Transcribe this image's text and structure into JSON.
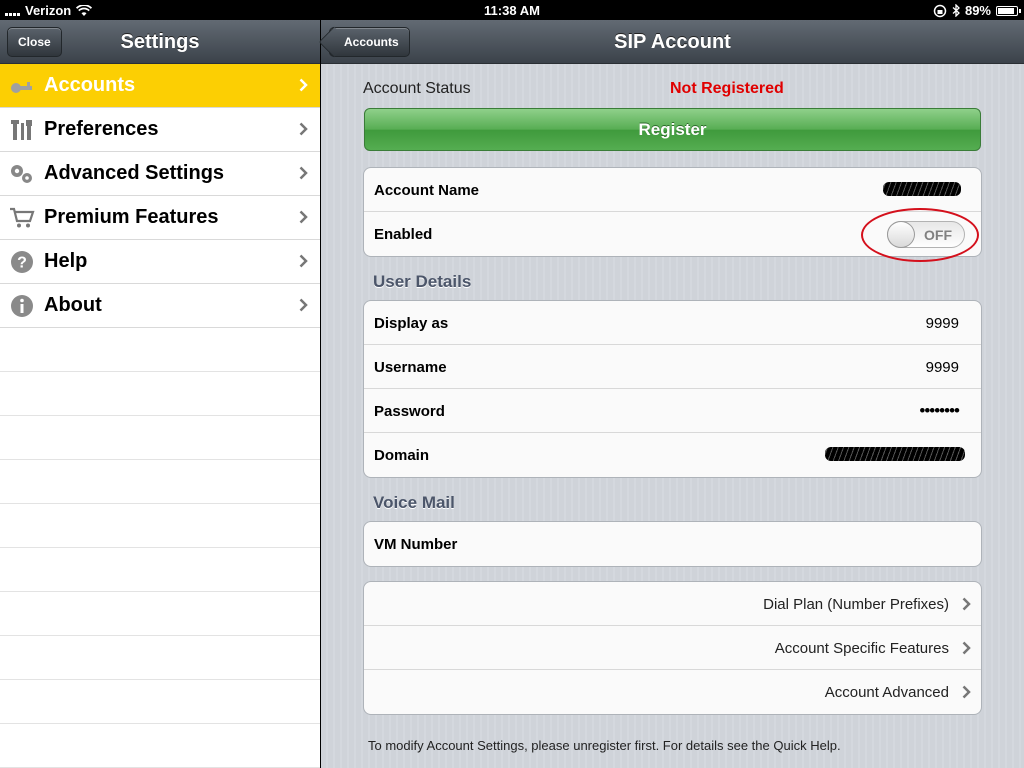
{
  "status_bar": {
    "carrier": "Verizon",
    "time": "11:38 AM",
    "battery": "89%",
    "battery_level": 0.89
  },
  "left_pane": {
    "title": "Settings",
    "close_label": "Close",
    "items": [
      {
        "label": "Accounts",
        "icon": "key-icon",
        "selected": true
      },
      {
        "label": "Preferences",
        "icon": "tools-icon",
        "selected": false
      },
      {
        "label": "Advanced Settings",
        "icon": "gears-icon",
        "selected": false
      },
      {
        "label": "Premium Features",
        "icon": "cart-icon",
        "selected": false
      },
      {
        "label": "Help",
        "icon": "help-icon",
        "selected": false
      },
      {
        "label": "About",
        "icon": "info-icon",
        "selected": false
      }
    ]
  },
  "right_pane": {
    "title": "SIP Account",
    "back_label": "Accounts",
    "account_status_label": "Account Status",
    "account_status_value": "Not Registered",
    "register_label": "Register",
    "account": {
      "name_label": "Account Name",
      "enabled_label": "Enabled",
      "enabled_value": "OFF"
    },
    "user_details": {
      "header": "User Details",
      "display_as_label": "Display as",
      "display_as_value": "9999",
      "username_label": "Username",
      "username_value": "9999",
      "password_label": "Password",
      "password_value": "••••••••",
      "domain_label": "Domain"
    },
    "voice_mail": {
      "header": "Voice Mail",
      "vm_number_label": "VM Number"
    },
    "links": {
      "dial_plan": "Dial Plan (Number Prefixes)",
      "account_specific": "Account Specific Features",
      "account_advanced": "Account Advanced"
    },
    "footnote": "To modify Account Settings, please unregister first.  For details see the Quick Help."
  },
  "colors": {
    "accent_yellow": "#fccf03",
    "status_red": "#e00000",
    "register_green": "#57ad53"
  }
}
